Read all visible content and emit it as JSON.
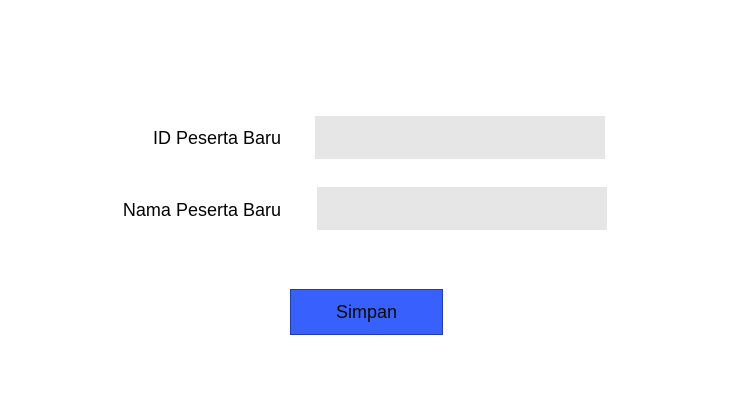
{
  "form": {
    "id_label": "ID Peserta Baru",
    "id_value": "",
    "name_label": "Nama Peserta Baru",
    "name_value": "",
    "save_label": "Simpan"
  },
  "colors": {
    "field_background": "#e6e6e6",
    "button_background": "#3860fc"
  }
}
